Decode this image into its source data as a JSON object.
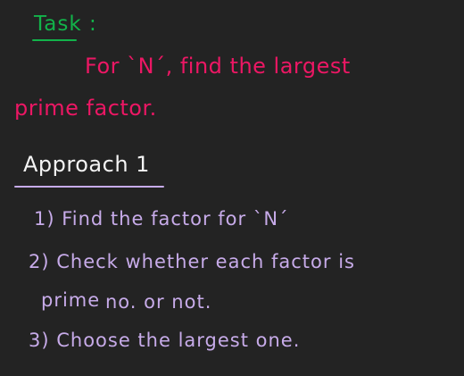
{
  "colors": {
    "background": "#232323",
    "green": "#12b34a",
    "pink": "#ec1764",
    "white": "#f4f4f4",
    "lavender": "#c7abe9"
  },
  "task": {
    "heading": "Task :",
    "line1": "For `N´, find the largest",
    "line2": "prime factor."
  },
  "approach": {
    "heading": "Approach 1",
    "steps": [
      "1) Find the factor for `N´",
      "2) Check whether each factor is",
      "prime",
      "no. or not.",
      "3) Choose the largest one."
    ]
  }
}
